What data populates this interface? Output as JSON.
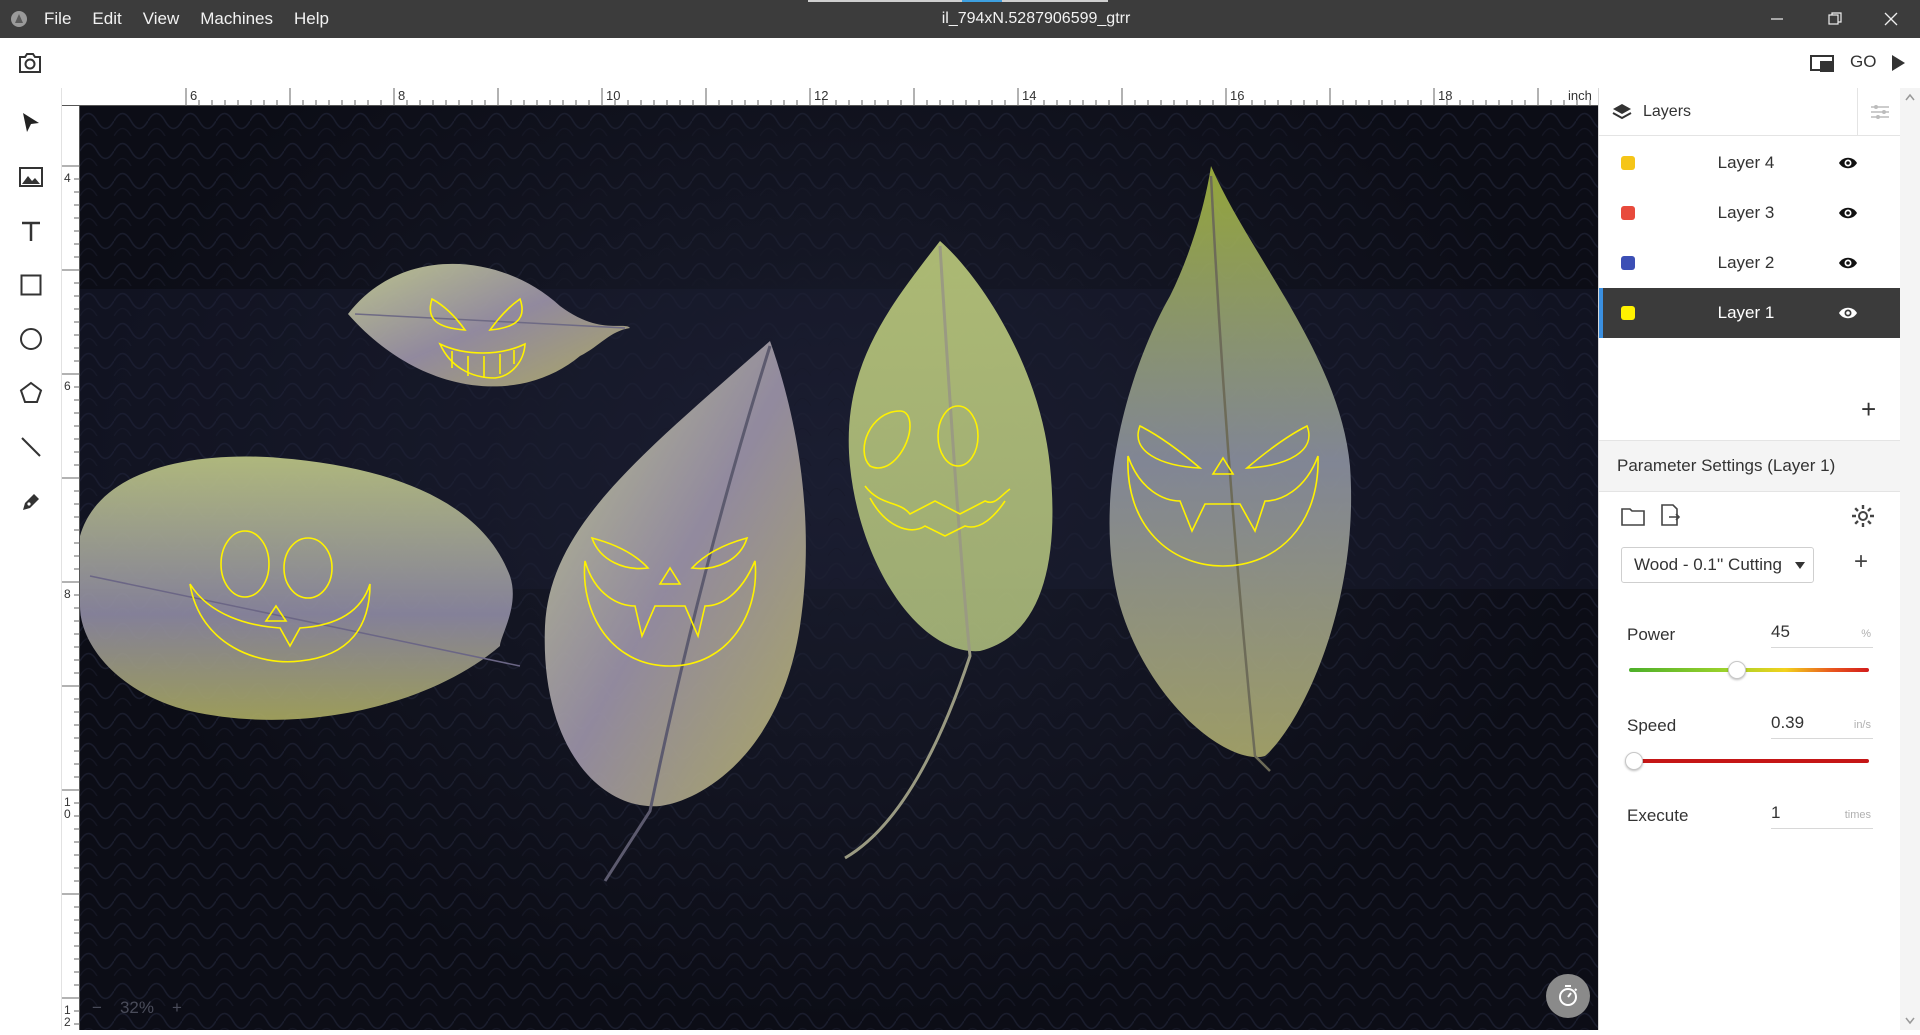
{
  "app": {
    "window_title": "il_794xN.5287906599_gtrr",
    "menu": [
      "File",
      "Edit",
      "View",
      "Machines",
      "Help"
    ]
  },
  "toolbar": {
    "go_label": "GO"
  },
  "rulers": {
    "unit": "inch",
    "top_ticks": [
      "6",
      "8",
      "10",
      "12",
      "14",
      "16",
      "18"
    ],
    "left_ticks": [
      "4",
      "6",
      "8",
      "10",
      "12"
    ]
  },
  "canvas": {
    "zoom_level": "32%"
  },
  "layers_panel": {
    "title": "Layers",
    "layers": [
      {
        "name": "Layer 4",
        "color": "#f5c518",
        "visible": true,
        "active": false
      },
      {
        "name": "Layer 3",
        "color": "#e84a3c",
        "visible": true,
        "active": false
      },
      {
        "name": "Layer 2",
        "color": "#3c4fb5",
        "visible": true,
        "active": false
      },
      {
        "name": "Layer 1",
        "color": "#fff200",
        "visible": true,
        "active": true
      }
    ]
  },
  "parameters": {
    "title": "Parameter Settings (Layer 1)",
    "preset": "Wood - 0.1'' Cutting",
    "power": {
      "label": "Power",
      "value": "45",
      "unit": "%",
      "level": 0.45
    },
    "speed": {
      "label": "Speed",
      "value": "0.39",
      "unit": "in/s",
      "level": 0.02
    },
    "execute": {
      "label": "Execute",
      "value": "1",
      "unit": "times"
    }
  },
  "colors": {
    "titlebar": "#3c3c3c",
    "accent": "#3a8fe0",
    "outline": "#fff200"
  }
}
